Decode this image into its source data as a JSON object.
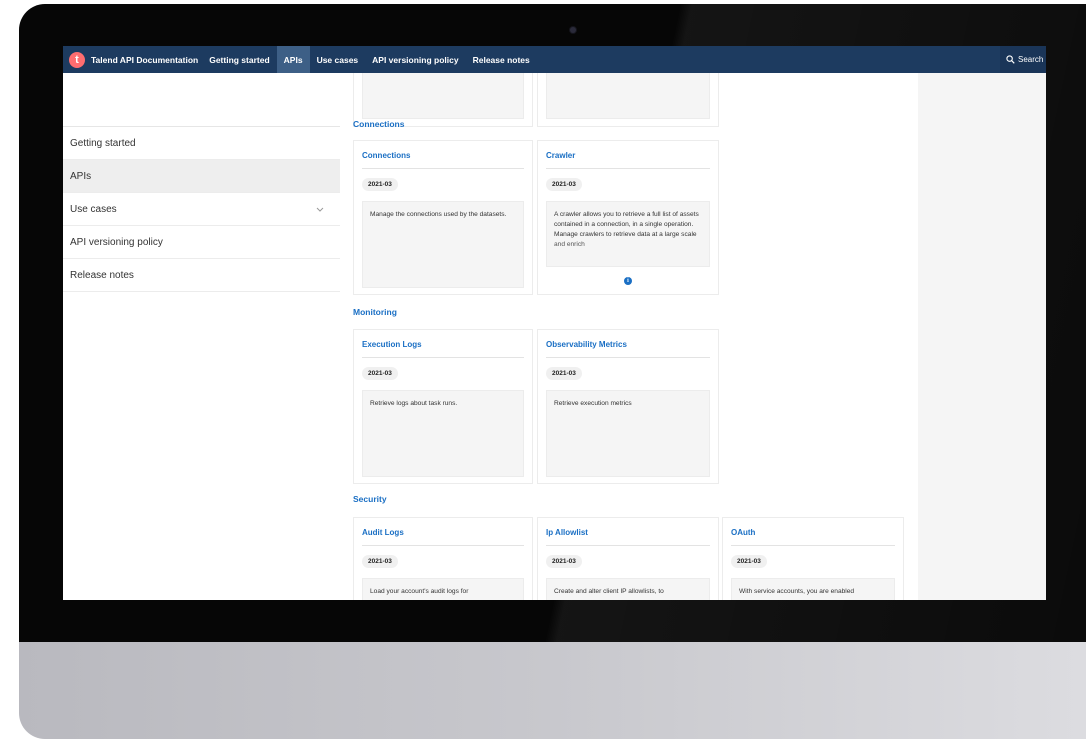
{
  "navbar": {
    "logo_letter": "t",
    "brand": "Talend API Documentation",
    "links": [
      {
        "label": "Getting started"
      },
      {
        "label": "APIs"
      },
      {
        "label": "Use cases"
      },
      {
        "label": "API versioning policy"
      },
      {
        "label": "Release notes"
      }
    ],
    "active_link": "APIs",
    "search_label": "Search"
  },
  "sidebar": {
    "items": [
      {
        "label": "Getting started"
      },
      {
        "label": "APIs"
      },
      {
        "label": "Use cases"
      },
      {
        "label": "API versioning policy"
      },
      {
        "label": "Release notes"
      }
    ],
    "active_item": "APIs"
  },
  "sections": {
    "connections": {
      "title": "Connections",
      "cards": [
        {
          "title": "Connections",
          "version": "2021-03",
          "description": "Manage the connections used by the datasets."
        },
        {
          "title": "Crawler",
          "version": "2021-03",
          "description": "A crawler allows you to retrieve a full list of assets contained in a connection, in a single operation. Manage crawlers to retrieve data at a large scale and enrich"
        }
      ],
      "more_icon": "info-icon"
    },
    "monitoring": {
      "title": "Monitoring",
      "cards": [
        {
          "title": "Execution Logs",
          "version": "2021-03",
          "description": "Retrieve logs about task runs."
        },
        {
          "title": "Observability Metrics",
          "version": "2021-03",
          "description": "Retrieve execution metrics"
        }
      ]
    },
    "security": {
      "title": "Security",
      "cards": [
        {
          "title": "Audit Logs",
          "version": "2021-03",
          "description": "Load your account's audit logs for"
        },
        {
          "title": "Ip Allowlist",
          "version": "2021-03",
          "description": "Create and alter client IP allowlists, to"
        },
        {
          "title": "OAuth",
          "version": "2021-03",
          "description": "With service accounts, you are enabled"
        }
      ]
    }
  },
  "colors": {
    "navbar": "#1d3b60",
    "nav_active": "#3d5f86",
    "accent_link": "#1a6fc4",
    "logo": "#ff6d70"
  }
}
